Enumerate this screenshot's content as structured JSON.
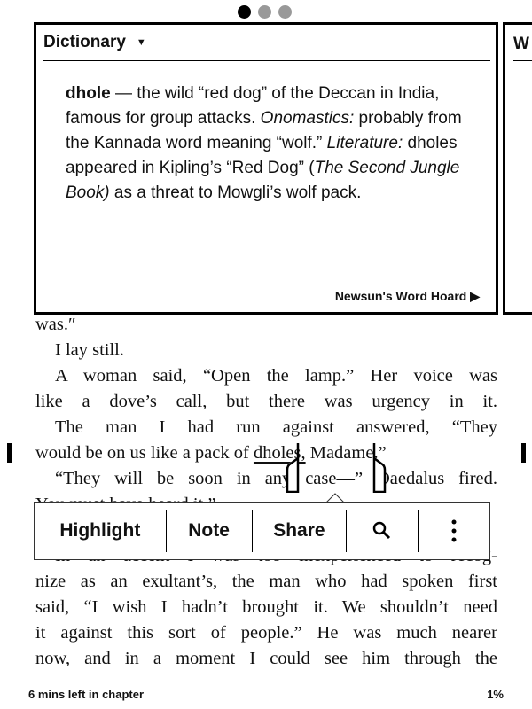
{
  "pager": {
    "pages": 3,
    "active": 0
  },
  "dictionary": {
    "title": "Dictionary",
    "caret": "▼",
    "headword": "dhole",
    "def_1": " — the wild “red dog” of the Deccan in India, famous for group attacks. ",
    "label_1": "Onomastics:",
    "def_2": " probably from the Kannada word meaning “wolf.” ",
    "label_2": "Literature:",
    "def_3": " dholes appeared in Kipling’s “Red Dog” (",
    "book_title": "The Second Jungle Book)",
    "def_4": " as a threat to Mowgli’s wolf pack.",
    "source": "Newsun's Word Hoard ▶"
  },
  "next_card": {
    "title_partial": "W"
  },
  "book": {
    "lines": [
      "was.″",
      "I lay still.",
      "A woman said, “Open the lamp.” Her voice was",
      "like a dove’s call, but there was urgency in it.",
      "The man I had run against answered, “They",
      "would be on us like a pack of ",
      "“They will be soon in any case—” Daedalus fired.",
      "You must have heard it.”",
      "In an accent I was too inexperienced to recog-",
      "nize as an exultant’s, the man who had spoken first",
      "said, “I wish I hadn’t brought it. We shouldn’t need",
      "it against this sort of people.” He was much nearer",
      "now, and in a moment I could see him through the"
    ],
    "selected_word": "dholes,",
    "after_selection": " Madame.”"
  },
  "popup": {
    "highlight": "Highlight",
    "note": "Note",
    "share": "Share",
    "search_icon": "search-icon",
    "more_icon": "more-vertical-icon"
  },
  "footer": {
    "time_left": "6 mins left in chapter",
    "progress": "1%"
  }
}
